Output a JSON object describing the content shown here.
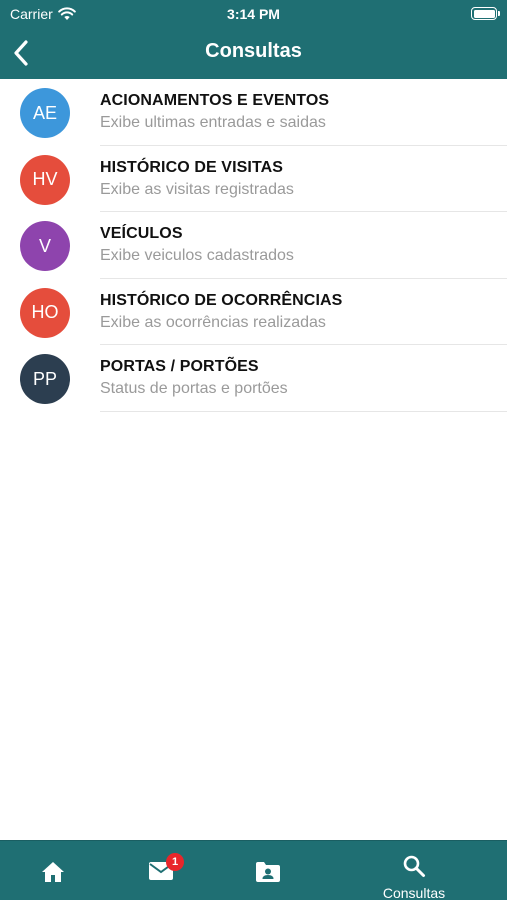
{
  "status_bar": {
    "carrier": "Carrier",
    "time": "3:14 PM"
  },
  "nav": {
    "title": "Consultas"
  },
  "items": [
    {
      "initials": "AE",
      "color": "#3d97db",
      "title": "ACIONAMENTOS E EVENTOS",
      "subtitle": "Exibe ultimas entradas e saidas"
    },
    {
      "initials": "HV",
      "color": "#e54d3c",
      "title": "HISTÓRICO DE VISITAS",
      "subtitle": "Exibe as visitas registradas"
    },
    {
      "initials": "V",
      "color": "#8e44ad",
      "title": "VEÍCULOS",
      "subtitle": "Exibe veiculos cadastrados"
    },
    {
      "initials": "HO",
      "color": "#e54d3c",
      "title": "HISTÓRICO DE OCORRÊNCIAS",
      "subtitle": "Exibe as ocorrências realizadas"
    },
    {
      "initials": "PP",
      "color": "#2c3e50",
      "title": "PORTAS / PORTÕES",
      "subtitle": "Status de portas e portões"
    }
  ],
  "tabbar": {
    "tabs": [
      {
        "icon": "home-icon"
      },
      {
        "icon": "mail-icon",
        "badge": "1"
      },
      {
        "icon": "contacts-folder-icon"
      },
      {
        "icon": "search-icon",
        "label": "Consultas"
      }
    ]
  },
  "colors": {
    "primary": "#1f6f73"
  }
}
